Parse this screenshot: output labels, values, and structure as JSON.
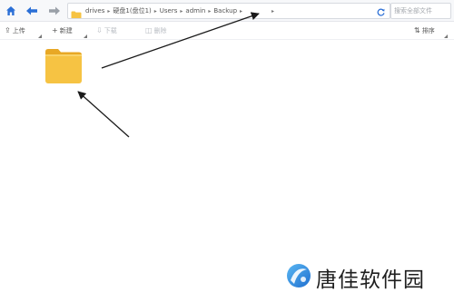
{
  "nav": {
    "home_icon": "home-icon",
    "back_icon": "arrow-left-icon",
    "forward_icon": "arrow-right-icon",
    "breadcrumbs": [
      "drives",
      "硬盘1(盘位1)",
      "Users",
      "admin",
      "Backup"
    ],
    "refresh_icon": "refresh-icon",
    "search_placeholder": "搜索全部文件"
  },
  "toolbar": {
    "upload_label": "上传",
    "new_label": "新建",
    "download_label": "下载",
    "delete_label": "删除",
    "sort_label": "排序"
  },
  "content": {
    "items": [
      {
        "type": "folder",
        "icon": "folder-icon",
        "name": ""
      }
    ]
  },
  "watermark": {
    "text": "唐佳软件园"
  },
  "colors": {
    "accent": "#2b6fd6",
    "folder": "#f6c343",
    "folder_dark": "#e8a825",
    "arrow": "#1a1a1a"
  }
}
